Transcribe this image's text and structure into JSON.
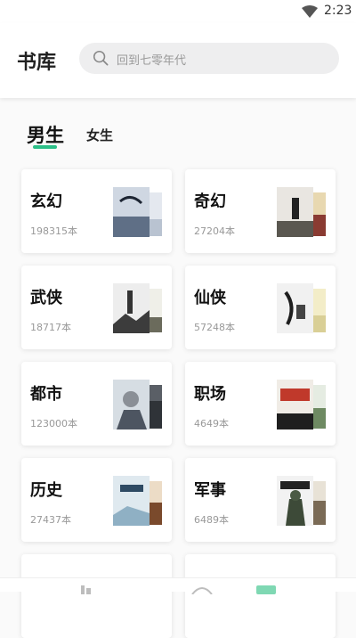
{
  "status": {
    "time": "2:23",
    "wifi_icon": "wifi-icon"
  },
  "header": {
    "title": "书库",
    "search": {
      "placeholder": "回到七零年代",
      "icon": "search-icon"
    }
  },
  "tabs": [
    {
      "label": "男生",
      "active": true
    },
    {
      "label": "女生",
      "active": false
    }
  ],
  "accent_color": "#2bbf87",
  "categories": [
    {
      "name": "玄幻",
      "count": "198315本"
    },
    {
      "name": "奇幻",
      "count": "27204本"
    },
    {
      "name": "武侠",
      "count": "18717本"
    },
    {
      "name": "仙侠",
      "count": "57248本"
    },
    {
      "name": "都市",
      "count": "123000本"
    },
    {
      "name": "职场",
      "count": "4649本"
    },
    {
      "name": "历史",
      "count": "27437本"
    },
    {
      "name": "军事",
      "count": "6489本"
    }
  ],
  "bottom_nav": {
    "icons": [
      "bookshelf-icon",
      "discover-icon",
      "library-icon"
    ]
  }
}
